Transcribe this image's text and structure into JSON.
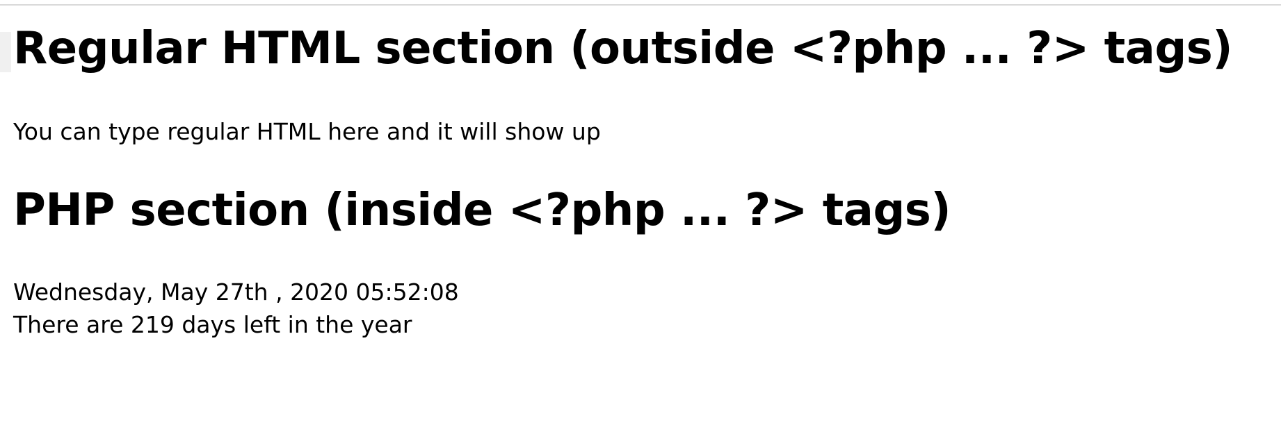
{
  "html_section": {
    "heading": "Regular HTML section (outside <?php ... ?> tags)",
    "text": "You can type regular HTML here and it will show up"
  },
  "php_section": {
    "heading": "PHP section (inside <?php ... ?> tags)",
    "date_line": "Wednesday, May 27th , 2020 05:52:08",
    "days_left_line": "There are 219 days left in the year"
  }
}
